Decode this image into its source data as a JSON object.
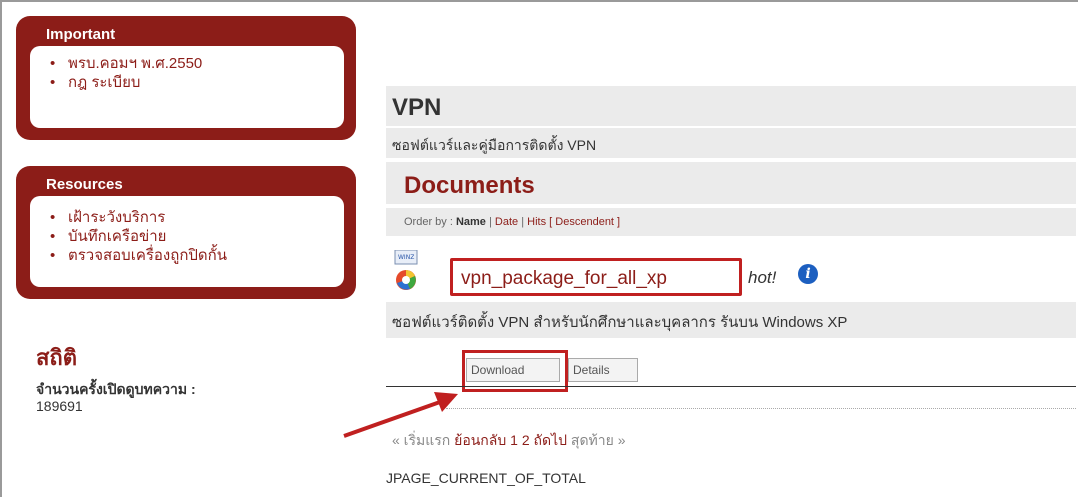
{
  "important": {
    "title": "Important",
    "items": [
      "พรบ.คอมฯ พ.ศ.2550",
      "กฎ ระเบียบ"
    ]
  },
  "resources": {
    "title": "Resources",
    "items": [
      "เฝ้าระวังบริการ",
      "บันทึกเครือข่าย",
      "ตรวจสอบเครื่องถูกปิดกั้น"
    ]
  },
  "stats": {
    "title": "สถิติ",
    "label": "จำนวนครั้งเปิดดูบทความ :",
    "value": "189691"
  },
  "category": {
    "title": "VPN",
    "description": "ซอฟต์แวร์และคู่มือการติดตั้ง VPN"
  },
  "documents": {
    "title": "Documents",
    "order_prefix": "Order by :",
    "order_name": "Name",
    "order_date": "Date",
    "order_hits": "Hits",
    "order_desc": "[ Descendent ]",
    "sep": "|"
  },
  "doc": {
    "icon_label": "WINZ",
    "name": "vpn_package_for_all_xp",
    "hot": "hot!",
    "info": "i",
    "description": "ซอฟต์แวร์ติดตั้ง VPN สำหรับนักศึกษาและบุคลากร รันบน Windows XP",
    "download_label": "Download",
    "details_label": "Details"
  },
  "pager": {
    "first": "« เริ่มแรก",
    "prev": "ย้อนกลับ",
    "page1": "1",
    "page2": "2",
    "next": "ถัดไป",
    "last": "สุดท้าย »",
    "status": "JPAGE_CURRENT_OF_TOTAL"
  },
  "colors": {
    "brand": "#8c1d18",
    "highlight": "#c02020",
    "panel": "#ebebeb"
  }
}
